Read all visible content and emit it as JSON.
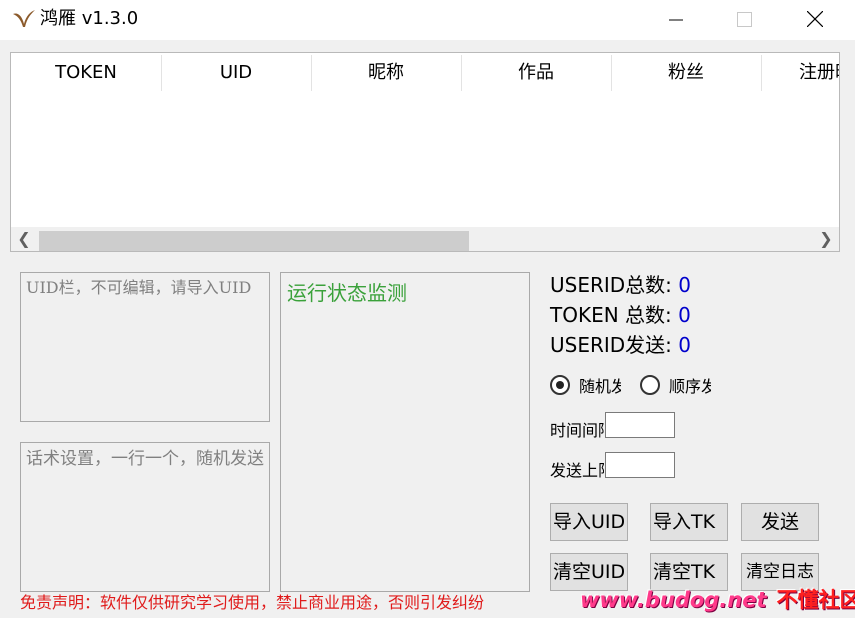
{
  "window": {
    "title": "鸿雁 v1.3.0",
    "logo_icon": "swallow-logo-icon",
    "controls": {
      "minimize_icon": "minimize-icon",
      "maximize_icon": "maximize-icon",
      "close_icon": "close-icon"
    }
  },
  "table": {
    "columns": [
      "TOKEN",
      "UID",
      "昵称",
      "作品",
      "粉丝",
      "注册时"
    ],
    "rows": [],
    "scroll_left_icon": "chevron-left-icon",
    "scroll_right_icon": "chevron-right-icon"
  },
  "inputs": {
    "uid_placeholder": "UID栏，不可编辑，请导入UID",
    "script_placeholder": "话术设置，一行一个，随机发送",
    "interval_value": "",
    "send_limit_value": ""
  },
  "monitor": {
    "title": "运行状态监测"
  },
  "stats": [
    {
      "label": "USERID总数: ",
      "value": "0"
    },
    {
      "label": "TOKEN 总数: ",
      "value": "0"
    },
    {
      "label": "USERID发送: ",
      "value": "0"
    }
  ],
  "mode": {
    "options": [
      {
        "label": "随机发送",
        "selected": true
      },
      {
        "label": "顺序发送",
        "selected": false
      }
    ]
  },
  "fields": {
    "interval_label": "时间间隔",
    "send_limit_label": "发送上限"
  },
  "buttons": {
    "import_uid": "导入UID",
    "import_tk": "导入TK",
    "send": "发送",
    "clear_uid": "清空UID",
    "clear_tk": "清空TK",
    "clear_log": "清空日志"
  },
  "footer": {
    "disclaimer": "免责声明：软件仅供研究学习使用，禁止商业用途，否则引发纠纷",
    "watermark_en": "www.budog.net",
    "watermark_cn": "不懂社区"
  },
  "colors": {
    "accent_green": "#3aa13a",
    "count_blue": "#0000cc",
    "disclaimer_red": "#e01b1b"
  }
}
